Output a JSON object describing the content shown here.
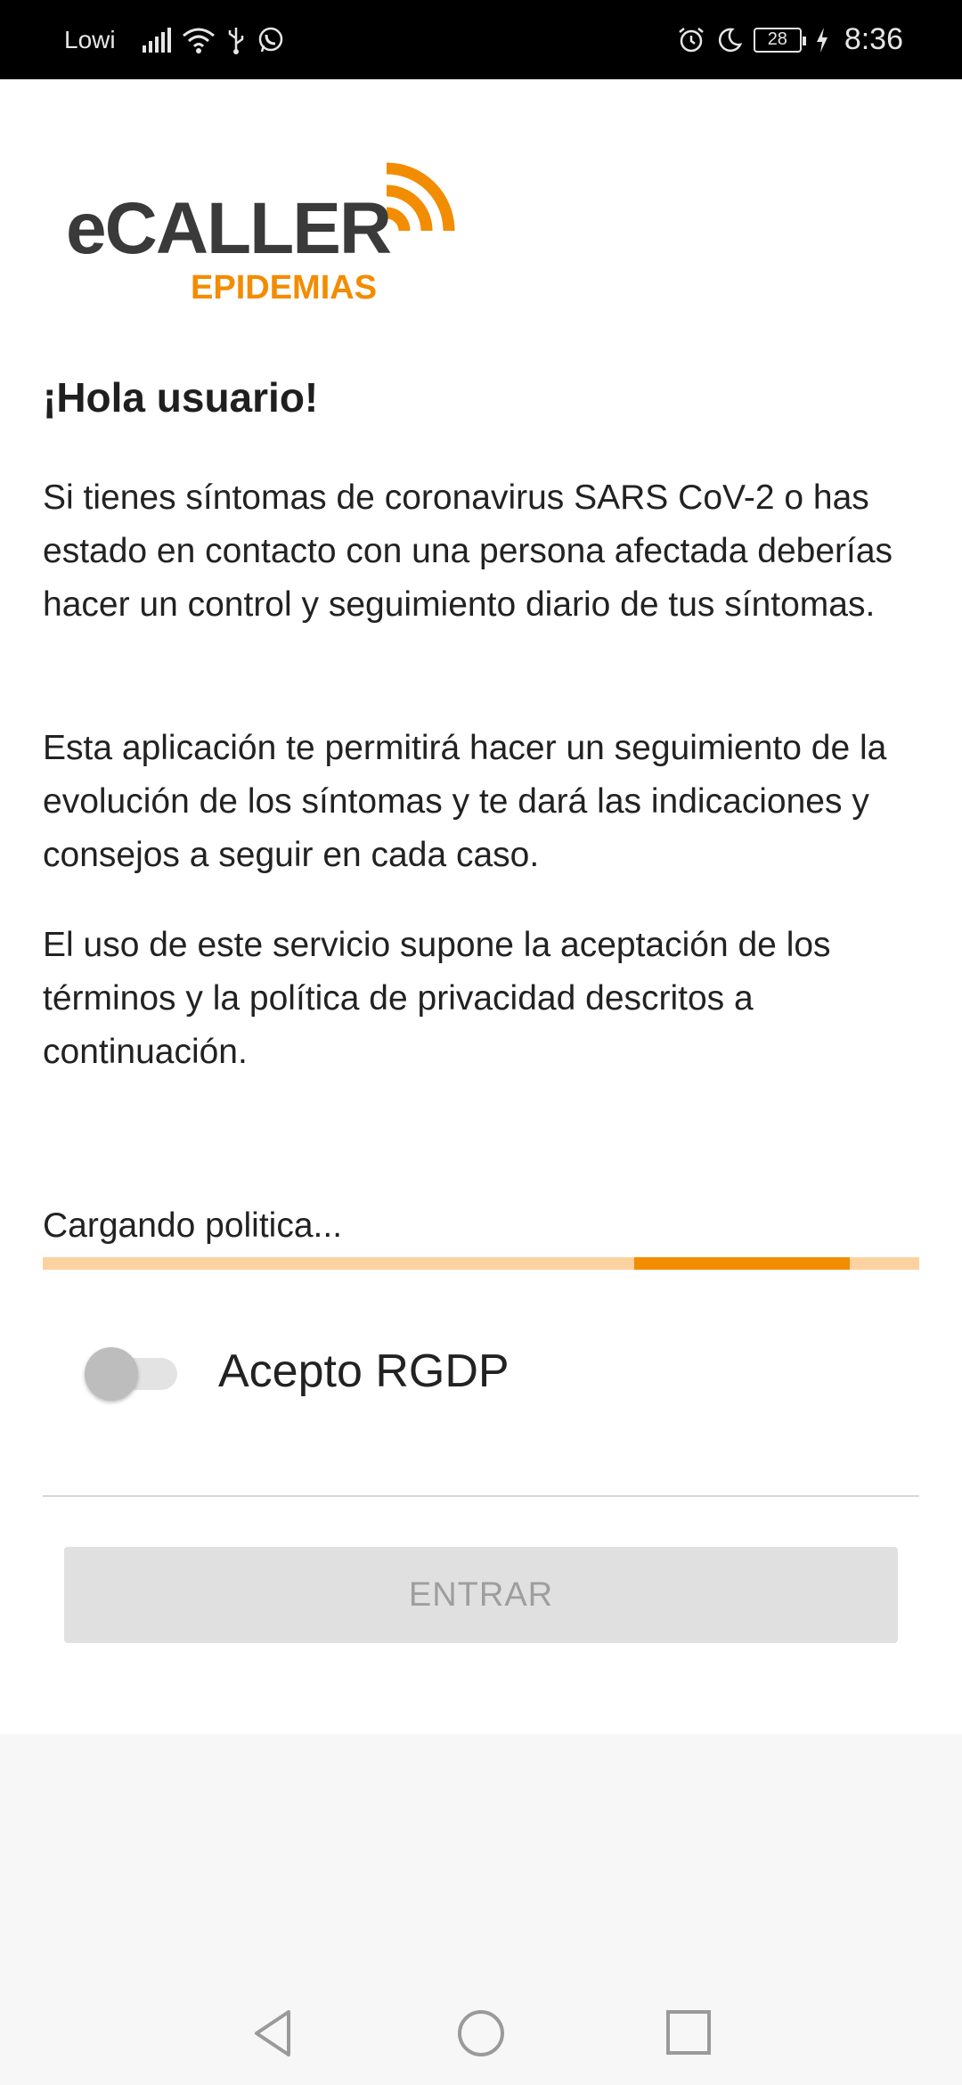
{
  "status_bar": {
    "carrier": "Lowi",
    "battery": "28",
    "time": "8:36",
    "icons": [
      "signal-icon",
      "wifi-icon",
      "usb-icon",
      "whatsapp-icon",
      "alarm-icon",
      "moon-icon",
      "charging-icon"
    ]
  },
  "logo": {
    "brand": "eCALLER",
    "subtitle": "EPIDEMIAS"
  },
  "main": {
    "greeting": "¡Hola usuario!",
    "paragraphs": [
      "Si tienes síntomas de coronavirus SARS CoV-2 o has estado en contacto con una persona afectada deberías hacer un control y seguimiento diario de tus síntomas.",
      "Esta aplicación te permitirá hacer un seguimiento de la evolución de los síntomas y te dará las indicaciones y consejos a seguir en cada caso.",
      "El uso de este servicio supone la aceptación de los términos y la política de privacidad descritos a continuación."
    ],
    "loading_label": "Cargando politica...",
    "consent_label": "Acepto RGDP",
    "consent_checked": false,
    "enter_button": "ENTRAR"
  },
  "colors": {
    "accent": "#f28c00",
    "accent_light": "#fcd3a0",
    "logo_gray": "#3a3a3a",
    "button_disabled": "#e0e0e0"
  },
  "nav": {
    "icons": [
      "back-icon",
      "home-icon",
      "recents-icon"
    ]
  }
}
